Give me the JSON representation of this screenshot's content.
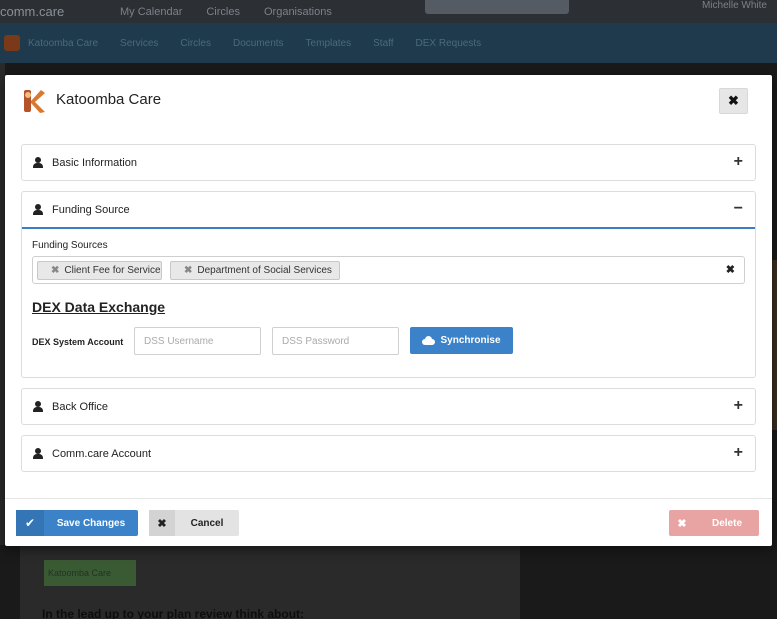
{
  "background": {
    "topbar": {
      "brand": "comm.care",
      "nav": [
        "My Calendar",
        "Circles",
        "Organisations"
      ],
      "user": "Michelle White"
    },
    "subnav": [
      "Katoomba Care",
      "Services",
      "Circles",
      "Documents",
      "Templates",
      "Staff",
      "DEX Requests"
    ],
    "content_tag": "Katoomba Care",
    "content_text": "In the lead up to your plan review think about:"
  },
  "modal": {
    "title": "Katoomba Care",
    "logo_icon": "katoomba-k-logo",
    "close_icon": "close-icon"
  },
  "panels": {
    "basic": {
      "title": "Basic Information",
      "toggle": "+"
    },
    "funding": {
      "title": "Funding Source",
      "toggle": "−"
    },
    "back_office": {
      "title": "Back Office",
      "toggle": "+"
    },
    "comm_account": {
      "title": "Comm.care Account",
      "toggle": "+"
    }
  },
  "funding": {
    "label": "Funding Sources",
    "tags": [
      "Client Fee for Service",
      "Department of Social Services"
    ],
    "tag_remove": "✖",
    "clear": "✖"
  },
  "dex": {
    "title": "DEX Data Exchange",
    "account_label": "DEX System Account",
    "username_placeholder": "DSS Username",
    "password_placeholder": "DSS Password",
    "sync_label": "Synchronise"
  },
  "footer": {
    "save_label": "Save Changes",
    "save_icon": "✔",
    "cancel_label": "Cancel",
    "cancel_icon": "✖",
    "delete_label": "Delete",
    "delete_icon": "✖"
  },
  "colors": {
    "primary": "#3b82c8",
    "danger_disabled": "#e8a3a3",
    "panel_active_border": "#3c7dc4"
  }
}
